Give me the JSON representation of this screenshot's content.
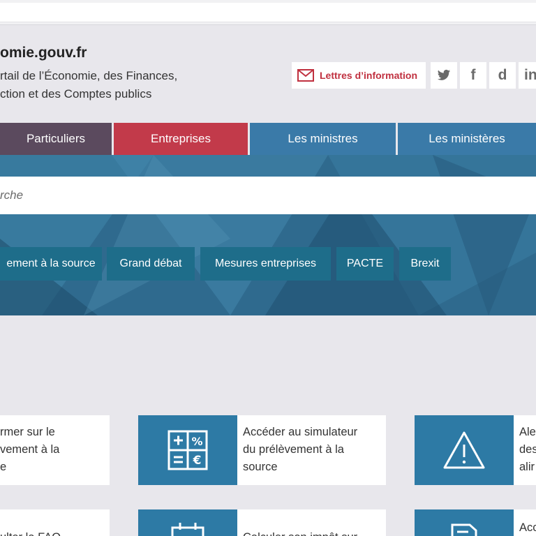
{
  "header": {
    "site_name": "omie.gouv.fr",
    "tagline_line1": "rtail de l’Économie, des Finances,",
    "tagline_line2": "ction et des Comptes publics",
    "newsletter_label": "Lettres d’information",
    "social": [
      "twitter-icon",
      "facebook-icon",
      "dailymotion-icon",
      "linkedin-icon"
    ],
    "social_glyphs": {
      "facebook": "f",
      "dailymotion": "d",
      "linkedin": "in"
    }
  },
  "nav": {
    "tabs": [
      {
        "label": "Particuliers",
        "color": "#5b4a5e"
      },
      {
        "label": "Entreprises",
        "color": "#c23a4a"
      },
      {
        "label": "Les ministres",
        "color": "#3a7aa8"
      },
      {
        "label": "Les ministères",
        "color": "#3a7aa8"
      }
    ]
  },
  "search": {
    "placeholder": "rche"
  },
  "quick_links": [
    "ement à la source",
    "Grand débat",
    "Mesures entreprises",
    "PACTE",
    "Brexit"
  ],
  "cards": [
    {
      "icon": "document-icon",
      "text": [
        "rmer sur le",
        "vement à la",
        "e"
      ]
    },
    {
      "icon": "calculator-icon",
      "text": [
        "Accéder au simulateur",
        "du prélèvement à la",
        "source"
      ]
    },
    {
      "icon": "warning-icon",
      "text": [
        "Ale",
        "des",
        "alir"
      ]
    },
    {
      "icon": "chat-icon",
      "text": [
        "ulter la FAQ"
      ]
    },
    {
      "icon": "calendar-icon",
      "text": [
        "Calculer son impôt sur"
      ]
    },
    {
      "icon": "file-icon",
      "text": [
        "Acc"
      ]
    }
  ],
  "colors": {
    "brand_red": "#c0303f",
    "accent_blue": "#2d7aa5",
    "chip_teal": "#1e6d8a"
  }
}
